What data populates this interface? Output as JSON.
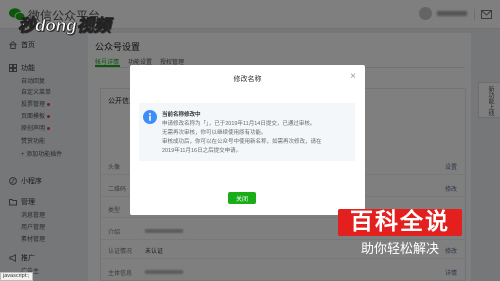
{
  "header": {
    "app_title": "微信公众平台"
  },
  "watermark": {
    "brand_text": "秒dong视频"
  },
  "sidebar": {
    "home_label": "首页",
    "features": {
      "label": "功能",
      "items": [
        "自动回复",
        "自定义菜单",
        "投票管理",
        "页面模板",
        "原创声明",
        "赞赏功能"
      ],
      "add_plugin": "+ 添加功能插件"
    },
    "miniprogram_label": "小程序",
    "manage": {
      "label": "管理",
      "items": [
        "消息管理",
        "用户管理",
        "素材管理"
      ]
    },
    "promote": {
      "label": "推广",
      "items": [
        "广告主"
      ]
    }
  },
  "main": {
    "page_title": "公众号设置",
    "tabs": [
      "帐号详情",
      "功能设置",
      "授权管理"
    ],
    "active_tab_index": 0,
    "section_title": "公开信息",
    "rows": [
      {
        "label": "头像",
        "action": "设置"
      },
      {
        "label": "二维码",
        "action": "修改"
      },
      {
        "label": "类型"
      },
      {
        "label": "介绍"
      },
      {
        "label": "认证情况",
        "value": "未认证",
        "action": "修改"
      },
      {
        "label": "主体信息",
        "action": "详情"
      }
    ]
  },
  "side_tab": {
    "label": "新功能上线"
  },
  "modal": {
    "title": "修改名称",
    "close_glyph": "×",
    "notice_title": "当前名称修改中",
    "notice_lines": [
      "申请修改名称为「」，已于2019年11月14日提交，已通过审核。",
      "无需再次审核，你可以继续使用原有功能。",
      "审核成功后，你可以在公众号中使用新名称，如需再次修改，请在",
      "2019年11月16日之后提交申请。"
    ],
    "close_button": "关闭"
  },
  "baike_logo": {
    "title": "百科全说",
    "slogan": "助你轻松解决"
  },
  "status_bar": {
    "text": "javascript:;"
  },
  "icons": {
    "logo": "wechat-logo-icon",
    "home": "home-icon",
    "features": "grid-icon",
    "miniprogram": "miniprogram-icon",
    "manage": "folder-icon",
    "promote": "megaphone-icon",
    "message": "mail-icon",
    "notice": "info-icon",
    "close": "close-icon"
  },
  "colors": {
    "wechat_green": "#1aad19",
    "info_blue": "#3e8ef7",
    "badge_red": "#e64340",
    "baike_red": "#e4201f",
    "link_blue": "#576b95",
    "overlay": "rgba(0,0,0,0.5)"
  }
}
